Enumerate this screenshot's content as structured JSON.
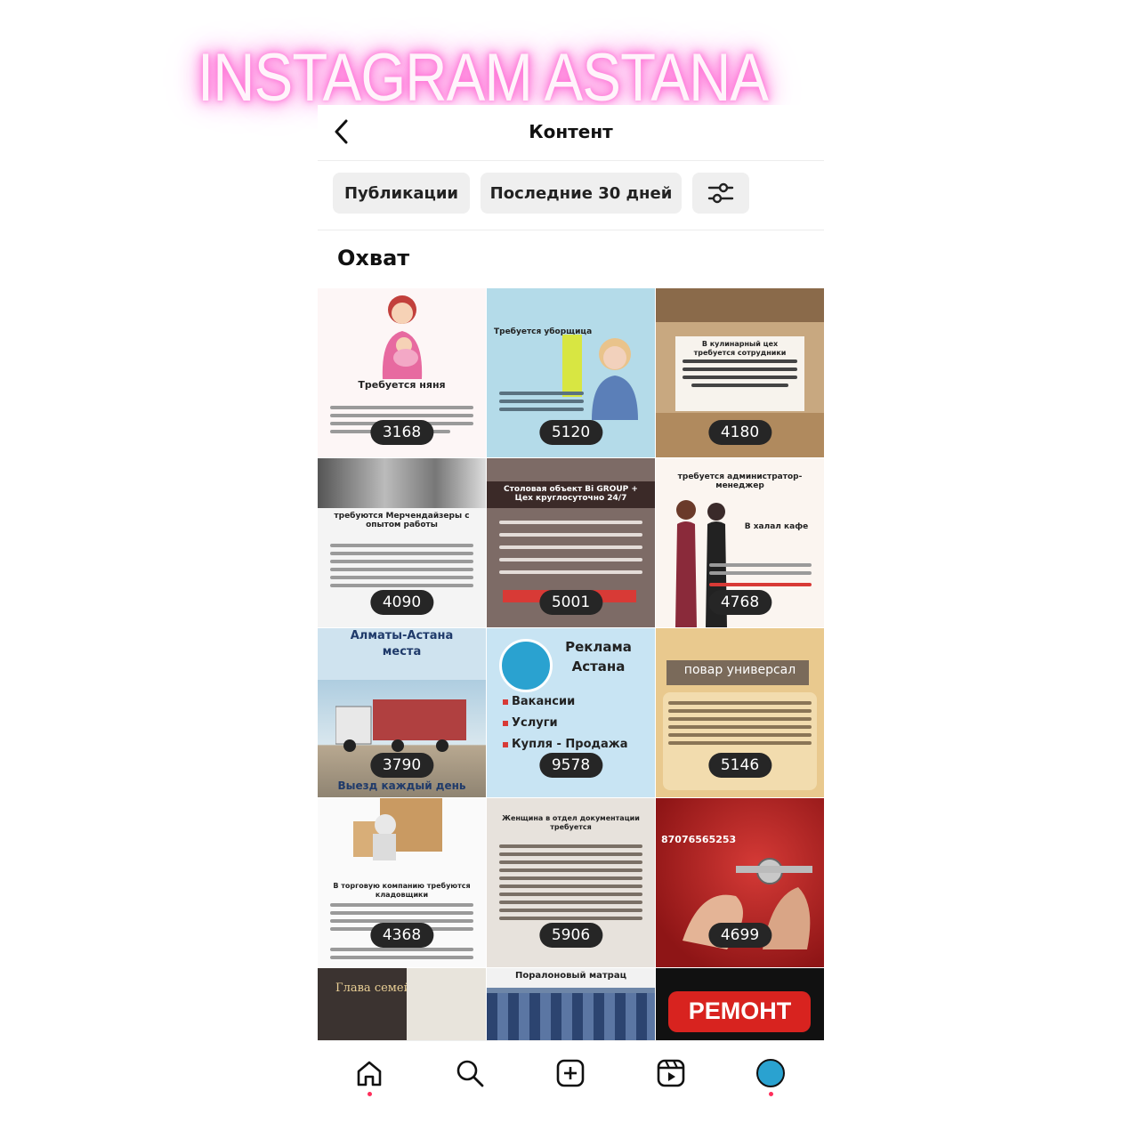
{
  "overlay_title": "INSTAGRAM ASTANA",
  "header": {
    "title": "Контент"
  },
  "filters": {
    "publications": "Публикации",
    "period": "Последние 30 дней"
  },
  "section_title": "Охват",
  "tiles": [
    {
      "heading": "Требуется няня",
      "reach": "3168"
    },
    {
      "heading": "Требуется уборщица",
      "reach": "5120"
    },
    {
      "heading": "В кулинарный цех требуется сотрудники",
      "reach": "4180"
    },
    {
      "heading": "требуются Мерчендайзеры с опытом работы",
      "reach": "4090"
    },
    {
      "heading": "Столовая объект Bi GROUP + Цех круглосуточно 24/7",
      "reach": "5001"
    },
    {
      "heading": "требуется администратор-менеджер",
      "subheading": "В халал кафе",
      "reach": "4768"
    },
    {
      "heading": "Алматы-Астана",
      "subheading": "места",
      "caption": "Выезд каждый день",
      "reach": "3790"
    },
    {
      "heading": "Реклама",
      "subheading": "Астана",
      "items": [
        "Вакансии",
        "Услуги",
        "Купля - Продажа"
      ],
      "reach": "9578"
    },
    {
      "heading": "повар универсал",
      "reach": "5146"
    },
    {
      "heading": "В торговую компанию требуются кладовщики",
      "reach": "4368"
    },
    {
      "heading": "Женщина в отдел документации требуется",
      "reach": "5906"
    },
    {
      "heading": "87076565253",
      "reach": "4699"
    },
    {
      "heading": "Глава семейства",
      "reach": ""
    },
    {
      "heading": "Поралоновый матрац",
      "reach": ""
    },
    {
      "heading": "РЕМОНТ",
      "reach": ""
    }
  ],
  "colors": {
    "accent": "#ff2e5b",
    "neon": "#ff55cc",
    "badge": "#262626"
  }
}
